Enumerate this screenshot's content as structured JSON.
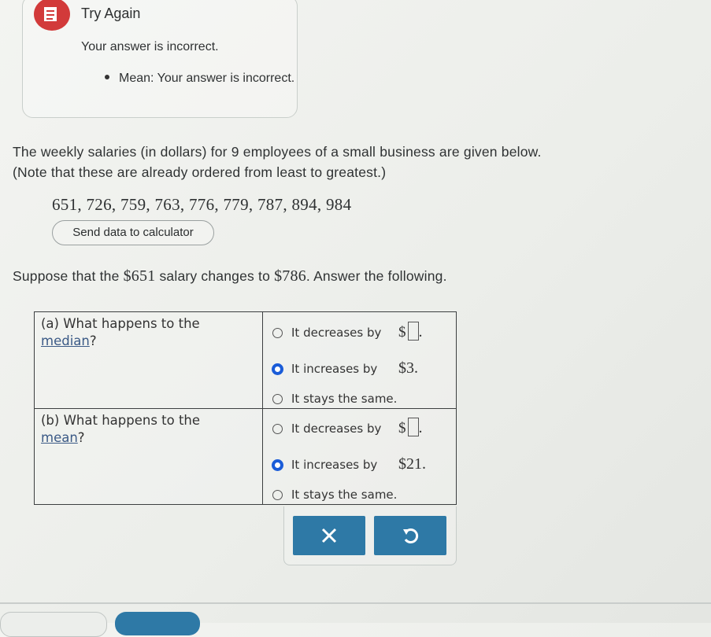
{
  "feedback": {
    "title": "Try Again",
    "message": "Your answer is incorrect.",
    "bullet": "Mean: Your answer is incorrect.",
    "icon": "try-again-icon",
    "icon_color": "#d23a3a"
  },
  "problem": {
    "line1": "The weekly salaries (in dollars) for 9 employees of a small business are given below.",
    "line2": "(Note that these are already ordered from least to greatest.)",
    "data": "651, 726, 759, 763, 776, 779, 787, 894, 984",
    "send_button": "Send data to calculator",
    "suppose_prefix": "Suppose that the ",
    "suppose_old": "$651",
    "suppose_mid": " salary changes to ",
    "suppose_new": "$786",
    "suppose_suffix": ". Answer the following."
  },
  "questions": {
    "a": {
      "label_prefix": "(a)  What happens to the",
      "label_link": "median",
      "label_suffix": "?",
      "options": [
        {
          "label": "It decreases by",
          "value": "",
          "selected": false
        },
        {
          "label": "It increases by",
          "value": "$3.",
          "selected": true
        },
        {
          "label": "It stays the same.",
          "selected": false
        }
      ]
    },
    "b": {
      "label_prefix": "(b)  What happens to the",
      "label_link": "mean",
      "label_suffix": "?",
      "options": [
        {
          "label": "It decreases by",
          "value": "",
          "selected": false
        },
        {
          "label": "It increases by",
          "value": "$21.",
          "selected": true
        },
        {
          "label": "It stays the same.",
          "selected": false
        }
      ]
    }
  },
  "dollar_sign": "$",
  "period": ".",
  "buttons": {
    "clear_icon": "close-icon",
    "undo_icon": "undo-icon",
    "accent": "#2e79a6"
  }
}
